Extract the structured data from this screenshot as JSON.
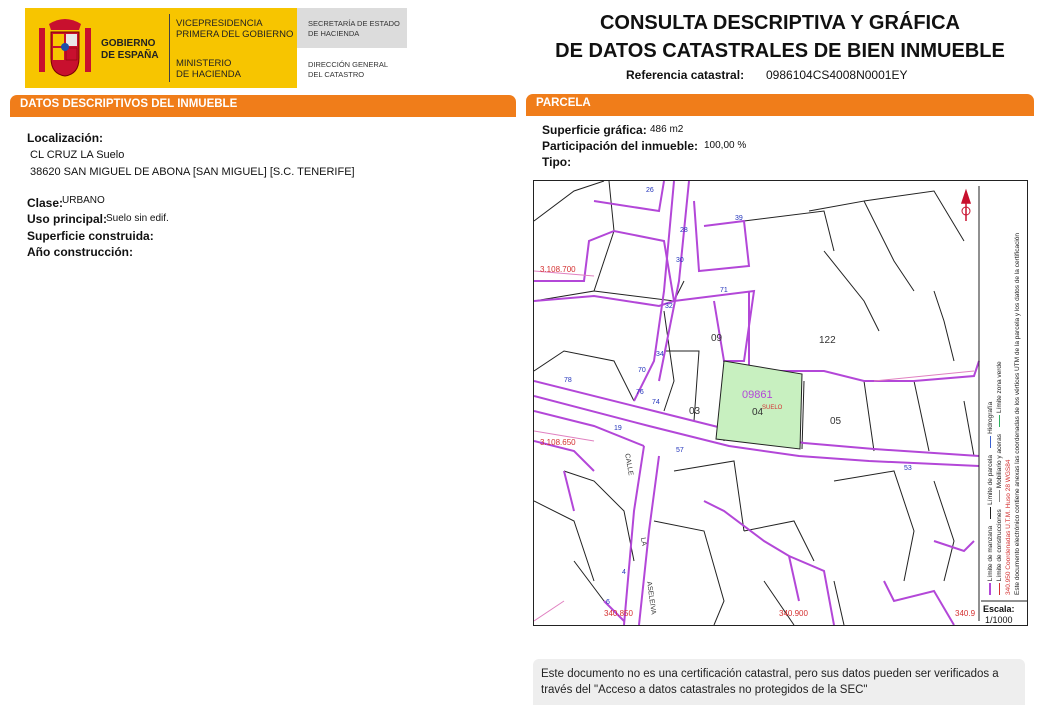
{
  "header": {
    "gov_name_line1": "GOBIERNO",
    "gov_name_line2": "DE ESPAÑA",
    "vice_line1": "VICEPRESIDENCIA",
    "vice_line2": "PRIMERA DEL GOBIERNO",
    "ministry_line1": "MINISTERIO",
    "ministry_line2": "DE HACIENDA",
    "sec_line1": "SECRETARÍA DE ESTADO",
    "sec_line2": "DE HACIENDA",
    "dir_line1": "DIRECCIÓN GENERAL",
    "dir_line2": "DEL CATASTRO",
    "title_line1": "CONSULTA DESCRIPTIVA Y GRÁFICA",
    "title_line2": "DE DATOS CATASTRALES DE BIEN INMUEBLE",
    "ref_label": "Referencia catastral:",
    "ref_value": "0986104CS4008N0001EY"
  },
  "left": {
    "section_title": "DATOS DESCRIPTIVOS DEL INMUEBLE",
    "localizacion_label": "Localización:",
    "address_line1": "CL CRUZ LA  Suelo",
    "address_line2": "38620 SAN MIGUEL DE ABONA [SAN MIGUEL] [S.C. TENERIFE]",
    "clase_label": "Clase:",
    "clase_value": "URBANO",
    "uso_label": "Uso principal:",
    "uso_value": "Suelo sin edif.",
    "superficie_label": "Superficie construida:",
    "anio_label": "Año construcción:"
  },
  "right": {
    "section_title": "PARCELA",
    "sup_label": "Superficie gráfica:",
    "sup_value": "486 m2",
    "part_label": "Participación del inmueble:",
    "part_value": "100,00 %",
    "tipo_label": "Tipo:"
  },
  "map": {
    "parcel_ref": "09861",
    "parcel_num": "04",
    "parcel_use": "SUELO",
    "labels": [
      "09",
      "122",
      "03",
      "05"
    ],
    "coord_top": "3.108.700",
    "coord_mid": "3.108.650",
    "coord_bottom_left": "340.850",
    "coord_bottom_mid": "340.900",
    "coord_bottom_right": "340.9",
    "street_name": "CALLE",
    "street_la": "LA",
    "street_asele": "ASELEIVA",
    "house_numbers": [
      "26",
      "28",
      "30",
      "32",
      "34",
      "39",
      "71",
      "70",
      "74",
      "76",
      "78",
      "19",
      "71",
      "57",
      "53",
      "4",
      "6"
    ],
    "scale_label": "Escala:",
    "scale_value": "1/1000",
    "legend": {
      "limite_manzana": "Límite de manzana",
      "limite_parcela": "Límite de parcela",
      "limite_construcciones": "Límite de construcciones",
      "mobiliario": "Mobiliario y aceras",
      "hidrografia": "Hidrografía",
      "zona_verde": "Límite zona verde",
      "coords_note": "340.950 Coordenadas U.T.M. Huso 28 WGS84",
      "doc_note": "Este documento electrónico contiene anexas las coordenadas de los vértices UTM de la parcela y los datos de la certificación"
    },
    "colors": {
      "block": "#b347d8",
      "parcel_fill": "#c8f0c0",
      "coord_red": "#d43030",
      "house_blue": "#2233bb"
    }
  },
  "notice": {
    "text": "Este documento no es una certificación catastral, pero sus datos pueden ser verificados a través del \"Acceso a datos catastrales no protegidos de la SEC\""
  }
}
